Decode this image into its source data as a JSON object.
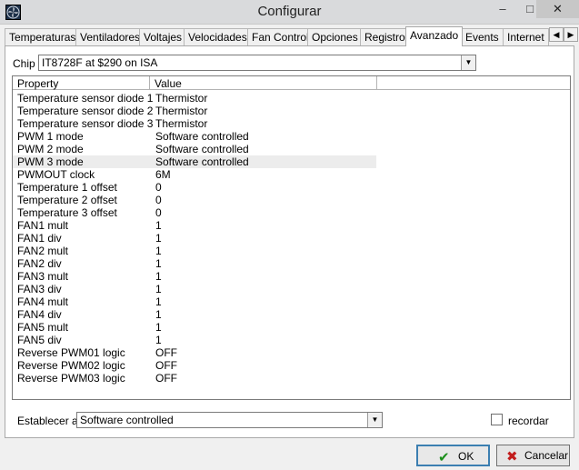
{
  "window": {
    "title": "Configurar",
    "minimize": "–",
    "maximize": "□",
    "close": "✕"
  },
  "tabs": [
    {
      "label": "Temperaturas"
    },
    {
      "label": "Ventiladores"
    },
    {
      "label": "Voltajes"
    },
    {
      "label": "Velocidades"
    },
    {
      "label": "Fan Control"
    },
    {
      "label": "Opciones"
    },
    {
      "label": "Registro"
    },
    {
      "label": "Avanzado"
    },
    {
      "label": "Events"
    },
    {
      "label": "Internet"
    }
  ],
  "active_tab": "Avanzado",
  "tab_scroll": {
    "left": "◀",
    "right": "▶"
  },
  "chip": {
    "label": "Chip",
    "value": "IT8728F at $290 on ISA",
    "dropdown_glyph": "▼"
  },
  "property_list": {
    "columns": [
      "Property",
      "Value"
    ],
    "selected_index": 5,
    "rows": [
      {
        "property": "Temperature sensor diode 1",
        "value": "Thermistor"
      },
      {
        "property": "Temperature sensor diode 2",
        "value": "Thermistor"
      },
      {
        "property": "Temperature sensor diode 3",
        "value": "Thermistor"
      },
      {
        "property": "PWM 1 mode",
        "value": "Software controlled"
      },
      {
        "property": "PWM 2 mode",
        "value": "Software controlled"
      },
      {
        "property": "PWM 3 mode",
        "value": "Software controlled"
      },
      {
        "property": "PWMOUT clock",
        "value": "6M"
      },
      {
        "property": "Temperature 1 offset",
        "value": "0"
      },
      {
        "property": "Temperature 2 offset",
        "value": "0"
      },
      {
        "property": "Temperature 3 offset",
        "value": "0"
      },
      {
        "property": "FAN1 mult",
        "value": "1"
      },
      {
        "property": "FAN1 div",
        "value": "1"
      },
      {
        "property": "FAN2 mult",
        "value": "1"
      },
      {
        "property": "FAN2 div",
        "value": "1"
      },
      {
        "property": "FAN3 mult",
        "value": "1"
      },
      {
        "property": "FAN3 div",
        "value": "1"
      },
      {
        "property": "FAN4 mult",
        "value": "1"
      },
      {
        "property": "FAN4 div",
        "value": "1"
      },
      {
        "property": "FAN5 mult",
        "value": "1"
      },
      {
        "property": "FAN5 div",
        "value": "1"
      },
      {
        "property": "Reverse PWM01 logic",
        "value": "OFF"
      },
      {
        "property": "Reverse PWM02 logic",
        "value": "OFF"
      },
      {
        "property": "Reverse PWM03 logic",
        "value": "OFF"
      }
    ]
  },
  "set_value": {
    "label": "Establecer a",
    "value": "Software controlled",
    "dropdown_glyph": "▼"
  },
  "remember": {
    "label": "recordar",
    "checked": false
  },
  "buttons": {
    "ok": {
      "label": "OK",
      "icon": "✔"
    },
    "cancel": {
      "label": "Cancelar",
      "icon": "✖"
    }
  }
}
